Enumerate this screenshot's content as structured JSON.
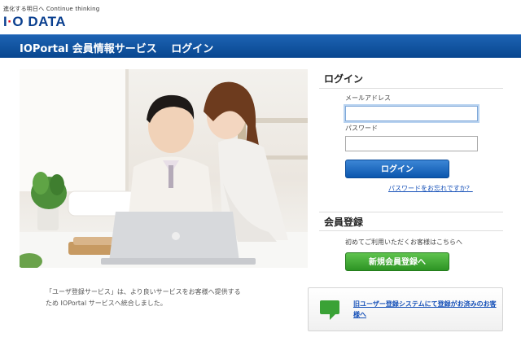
{
  "brand": {
    "tagline": "進化する明日へ Continue thinking",
    "logo_prefix": "I",
    "logo_dot": "·",
    "logo_main": "O DATA",
    "accent_color": "#0a3f8f",
    "dot_color": "#e60012"
  },
  "header": {
    "title": "IOPortal 会員情報サービス　 ログイン"
  },
  "notice": {
    "text": "「ユーザ登録サービス」は、より良いサービスをお客様へ提供する\nため IOPortal サービスへ統合しました。"
  },
  "login": {
    "heading": "ログイン",
    "email_label": "メールアドレス",
    "email_value": "",
    "password_label": "パスワード",
    "password_value": "",
    "button_label": "ログイン",
    "forgot_link": "パスワードをお忘れですか？"
  },
  "registration": {
    "heading": "会員登録",
    "description": "初めてご利用いただくお客様はこちらへ",
    "button_label": "新規会員登録へ"
  },
  "legacy": {
    "icon": "speech-bubble-icon",
    "link_text": "旧ユーザー登録システムにて登録がお済みのお客様へ"
  },
  "colors": {
    "header_bar": "#08468f",
    "login_button": "#0b56ad",
    "register_button": "#2d9424",
    "link": "#1550b8"
  }
}
